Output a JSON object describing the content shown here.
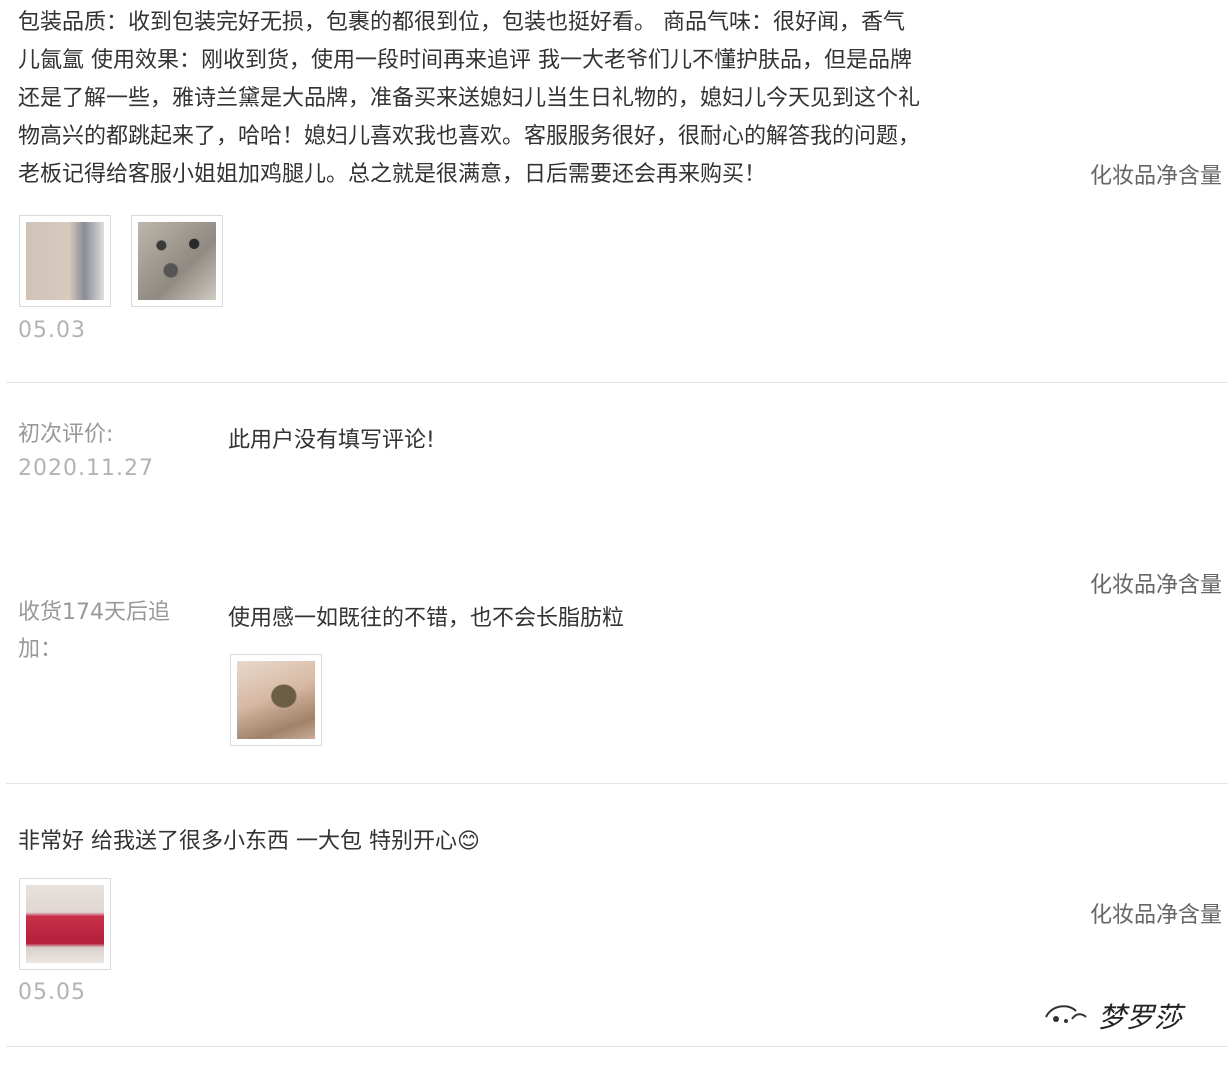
{
  "review1": {
    "lines": [
      "包装品质：收到包装完好无损，包裹的都很到位，包装也挺好看。 商品气味：很好闻，香气",
      "儿氤氲 使用效果：刚收到货，使用一段时间再来追评 我一大老爷们儿不懂护肤品，但是品牌",
      "还是了解一些，雅诗兰黛是大品牌，准备买来送媳妇儿当生日礼物的，媳妇儿今天见到这个礼",
      "物高兴的都跳起来了，哈哈！媳妇儿喜欢我也喜欢。客服服务很好，很耐心的解答我的问题，",
      "老板记得给客服小姐姐加鸡腿儿。总之就是很满意，日后需要还会再来购买！"
    ],
    "sku": "化妆品净含量",
    "date": "05.03"
  },
  "review2": {
    "initial_label": "初次评价:",
    "initial_date": "2020.11.27",
    "initial_text": "此用户没有填写评论!",
    "sku": "化妆品净含量",
    "followup_label_line1": "收货174天后追",
    "followup_label_line2": "加：",
    "followup_text": "使用感一如既往的不错，也不会长脂肪粒"
  },
  "review3": {
    "text": "非常好 给我送了很多小东西 一大包 特别开心😊",
    "sku": "化妆品净含量",
    "date": "05.05"
  },
  "watermark": {
    "text": "梦罗莎",
    "icon": "wechat-official-account-icon"
  }
}
